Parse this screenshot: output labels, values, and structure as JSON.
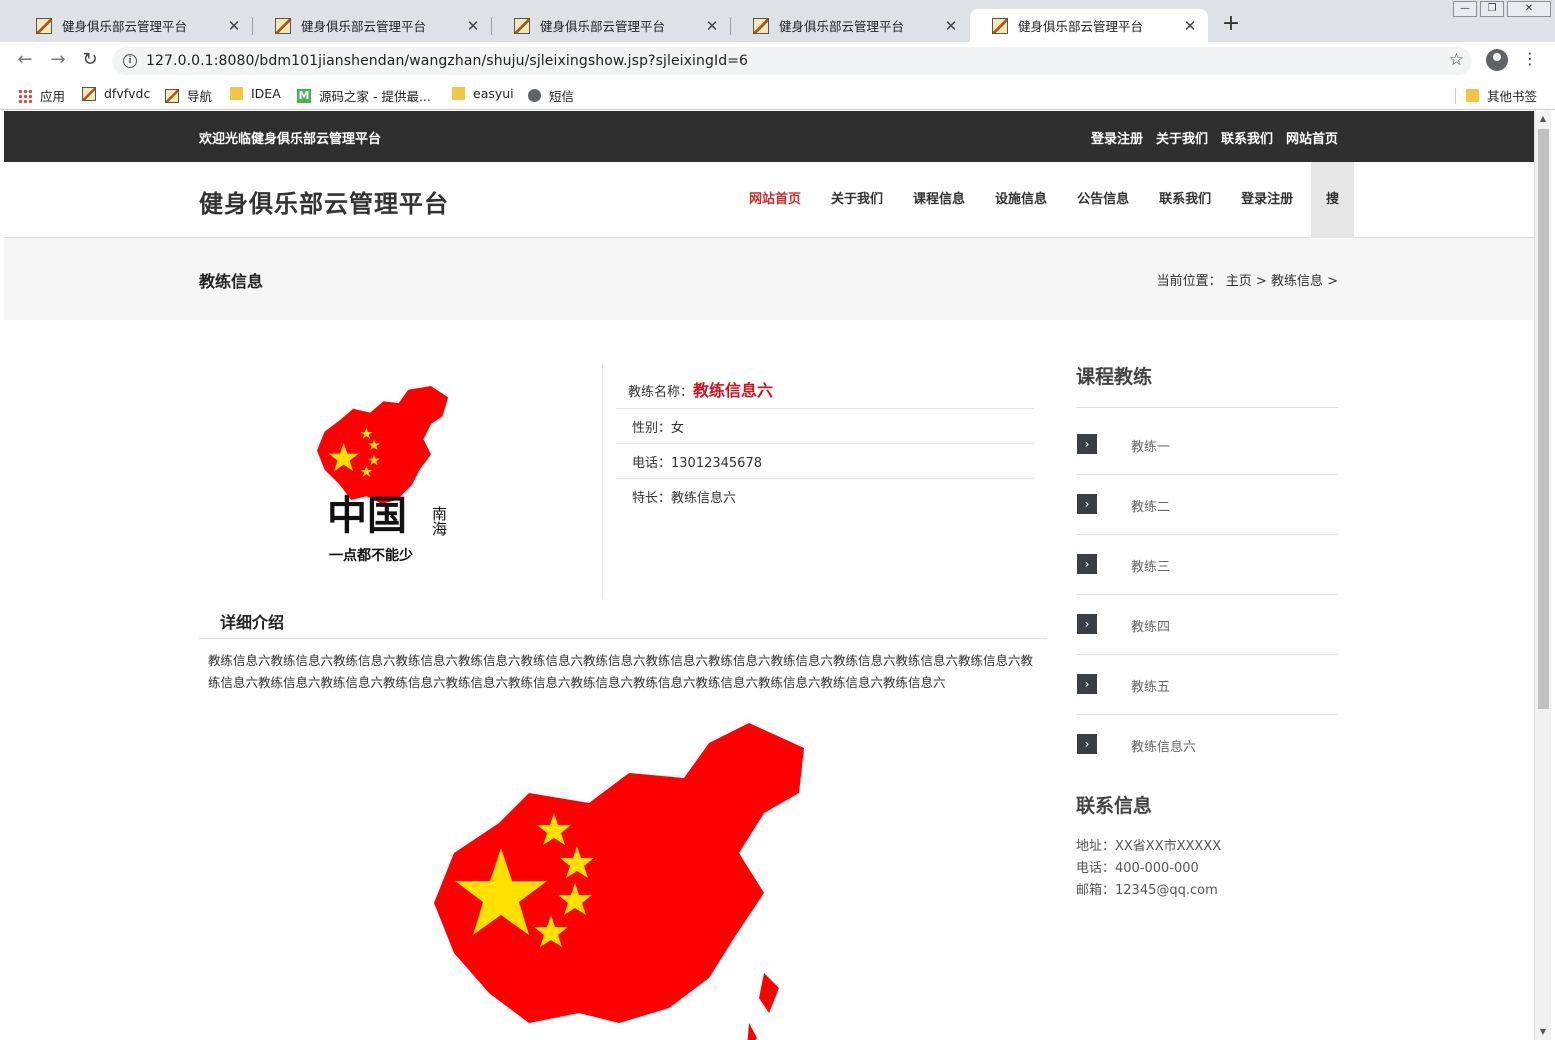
{
  "browser": {
    "tabs": [
      {
        "title": "健身俱乐部云管理平台",
        "active": false
      },
      {
        "title": "健身俱乐部云管理平台",
        "active": false
      },
      {
        "title": "健身俱乐部云管理平台",
        "active": false
      },
      {
        "title": "健身俱乐部云管理平台",
        "active": false
      },
      {
        "title": "健身俱乐部云管理平台",
        "active": true
      }
    ],
    "url": "127.0.0.1:8080/bdm101jianshendan/wangzhan/shuju/sjleixingshow.jsp?sjleixingId=6",
    "bookmarks": [
      {
        "label": "应用",
        "icon": "apps-grid-icon"
      },
      {
        "label": "dfvfvdc",
        "icon": "page-icon"
      },
      {
        "label": "导航",
        "icon": "page-icon"
      },
      {
        "label": "IDEA",
        "icon": "folder-icon"
      },
      {
        "label": "源码之家 - 提供最...",
        "icon": "m-logo-icon"
      },
      {
        "label": "easyui",
        "icon": "folder-icon"
      },
      {
        "label": "短信",
        "icon": "globe-icon"
      }
    ],
    "other_bookmarks": "其他书签"
  },
  "site": {
    "welcome": "欢迎光临健身俱乐部云管理平台",
    "top_links": [
      "登录注册",
      "关于我们",
      "联系我们",
      "网站首页"
    ],
    "logo": "健身俱乐部云管理平台",
    "nav": [
      "网站首页",
      "关于我们",
      "课程信息",
      "设施信息",
      "公告信息",
      "联系我们",
      "登录注册"
    ],
    "search_label": "搜",
    "accent_color": "#c9151e"
  },
  "breadcrumb": {
    "heading": "教练信息",
    "location": "当前位置： 主页 > 教练信息 >"
  },
  "coach": {
    "name_label": "教练名称：",
    "name": "教练信息六",
    "gender": "性别：女",
    "phone": "电话：13012345678",
    "specialty": "特长：教练信息六",
    "detail_heading": "详细介绍",
    "detail_text": "教练信息六教练信息六教练信息六教练信息六教练信息六教练信息六教练信息六教练信息六教练信息六教练信息六教练信息六教练信息六教练信息六教练信息六教练信息六教练信息六教练信息六教练信息六教练信息六教练信息六教练信息六教练信息六教练信息六教练信息六教练信息六",
    "image_caption_top": "中国",
    "image_caption_side": "南海",
    "image_caption_bottom": "一点都不能少"
  },
  "sidebar": {
    "coaches_heading": "课程教练",
    "coaches": [
      "教练一",
      "教练二",
      "教练三",
      "教练四",
      "教练五",
      "教练信息六"
    ],
    "contact_heading": "联系信息",
    "contact": [
      "地址：XX省XX市XXXXX",
      "电话：400-000-000",
      "邮箱：12345@qq.com"
    ]
  }
}
